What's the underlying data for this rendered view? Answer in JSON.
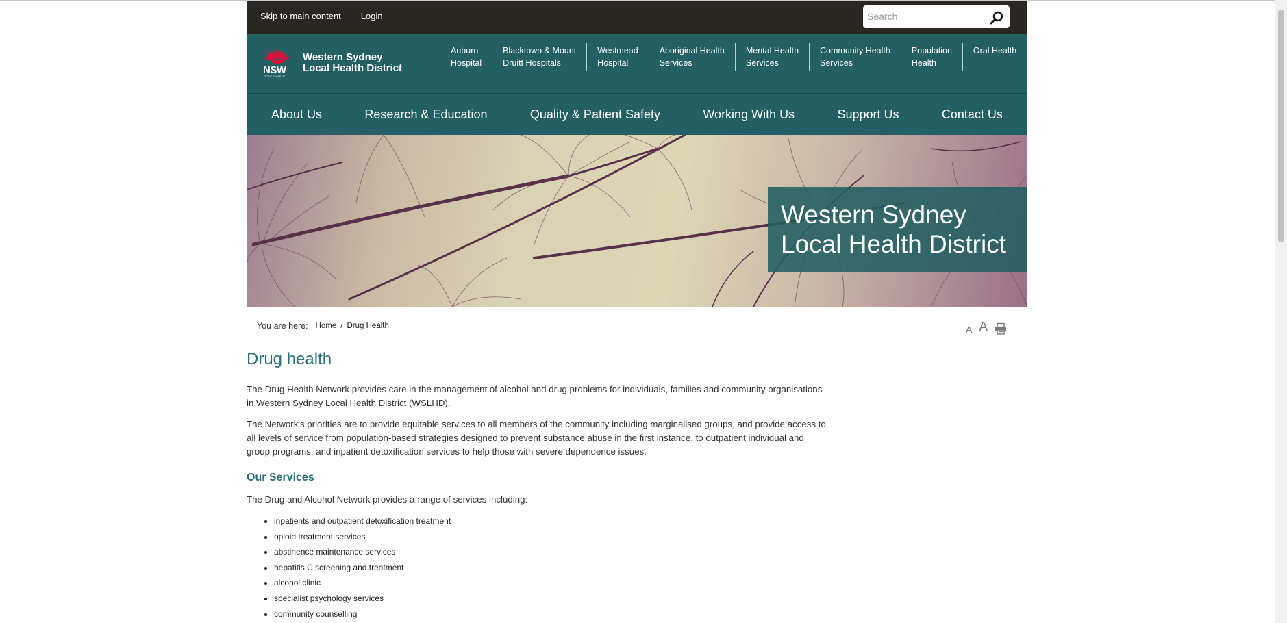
{
  "util": {
    "skip_link": "Skip to main content",
    "login": "Login",
    "search_placeholder": "Search"
  },
  "brand": {
    "nsw": "NSW",
    "government": "GOVERNMENT",
    "line1": "Western Sydney",
    "line2": "Local Health District"
  },
  "facilities": [
    {
      "line1": "Auburn",
      "line2": "Hospital"
    },
    {
      "line1": "Blacktown & Mount",
      "line2": "Druitt Hospitals"
    },
    {
      "line1": "Westmead",
      "line2": "Hospital"
    },
    {
      "line1": "Aboriginal Health",
      "line2": "Services"
    },
    {
      "line1": "Mental Health",
      "line2": "Services"
    },
    {
      "line1": "Community Health",
      "line2": "Services"
    },
    {
      "line1": "Population",
      "line2": "Health"
    },
    {
      "line1": "Oral Health",
      "line2": ""
    }
  ],
  "nav": [
    "About Us",
    "Research & Education",
    "Quality & Patient Safety",
    "Working With Us",
    "Support Us",
    "Contact Us"
  ],
  "hero": {
    "line1": "Western Sydney",
    "line2": "Local Health District"
  },
  "breadcrumb": {
    "label": "You are here:",
    "home": "Home",
    "separator": "/",
    "current": "Drug Health"
  },
  "tools": {
    "small": "A",
    "large": "A"
  },
  "content": {
    "title": "Drug health",
    "p1": "The Drug Health Network provides care in the management of alcohol and drug problems for individuals, families and community organisations in Western Sydney Local Health District (WSLHD).",
    "p2": "The Network's priorities are to provide equitable services to all members of the community including marginalised groups, and provide access to all levels of service from population-based strategies designed to prevent substance abuse in the first instance, to outpatient individual and group programs, and inpatient detoxification services to help those with severe dependence issues.",
    "services_heading": "Our Services",
    "services_intro": "The Drug and Alcohol Network provides a range of services including:",
    "services": [
      "inpatients and outpatient detoxification treatment",
      "opioid treatment services",
      "abstinence maintenance services",
      "hepatitis C screening and treatment",
      "alcohol clinic",
      "specialist psychology services",
      "community counselling"
    ]
  },
  "colors": {
    "header_teal": "#245f63",
    "utility_bar": "#2a2622",
    "heading_teal": "#2a6e78",
    "nsw_red": "#d7153a"
  }
}
